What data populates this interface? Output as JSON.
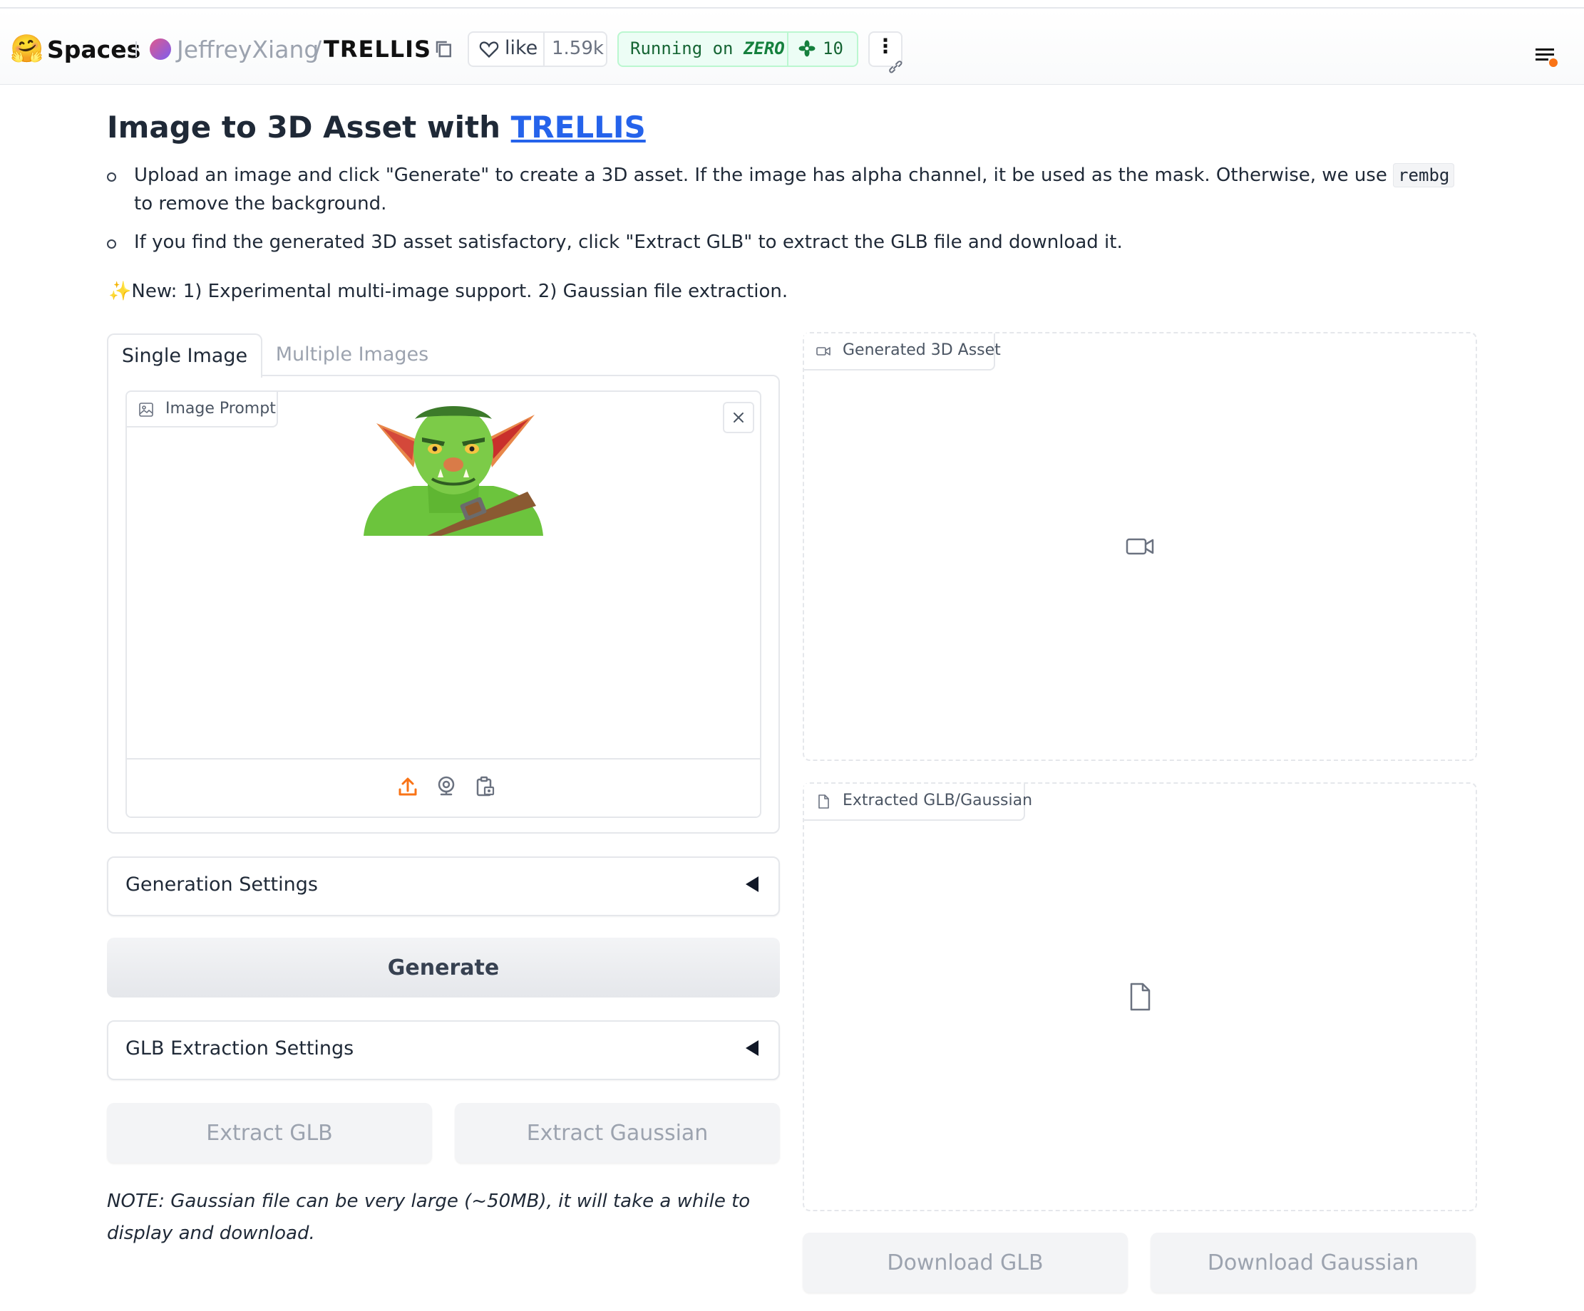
{
  "header": {
    "logo_emoji": "🤗",
    "spaces_label": "Spaces",
    "owner": "JeffreyXiang",
    "slash": "/",
    "repo": "TRELLIS",
    "like_label": "like",
    "like_count": "1.59k",
    "status_prefix": "Running on ",
    "status_hardware": "ZERO",
    "replica_count": "10",
    "more_glyph": "⋮"
  },
  "page": {
    "title_prefix": "Image to 3D Asset with ",
    "title_link": "TRELLIS",
    "bullet1_before": "Upload an image and click \"Generate\" to create a 3D asset. If the image has alpha channel, it be used as the mask. Otherwise, we use ",
    "bullet1_code": "rembg",
    "bullet1_after": " to remove the background.",
    "bullet2": "If you find the generated 3D asset satisfactory, click \"Extract GLB\" to extract the GLB file and download it.",
    "news_icon": "✨",
    "news_text": "New: 1) Experimental multi-image support. 2) Gaussian file extraction."
  },
  "tabs": {
    "single": "Single Image",
    "multiple": "Multiple Images",
    "active": "single"
  },
  "image_input": {
    "label": "Image Prompt",
    "close_glyph": "✕",
    "has_image": true,
    "source_icons": [
      "upload-icon",
      "webcam-icon",
      "clipboard-icon"
    ],
    "active_source_color": "#f97316"
  },
  "settings": {
    "generation": "Generation Settings",
    "glb_extraction": "GLB Extraction Settings",
    "generation_expanded": false,
    "glb_extraction_expanded": false
  },
  "buttons": {
    "generate": "Generate",
    "extract_glb": "Extract GLB",
    "extract_gaussian": "Extract Gaussian",
    "download_glb": "Download GLB",
    "download_gaussian": "Download Gaussian"
  },
  "note": "NOTE: Gaussian file can be very large (~50MB), it will take a while to display and download.",
  "outputs": {
    "video_label": "Generated 3D Asset",
    "file_label": "Extracted GLB/Gaussian",
    "video_icon": "video-camera-icon",
    "file_icon": "file-icon"
  },
  "colors": {
    "link": "#2563eb",
    "status_bg": "#ecfdf5",
    "status_text": "#166534",
    "notification_dot": "#f97316"
  }
}
